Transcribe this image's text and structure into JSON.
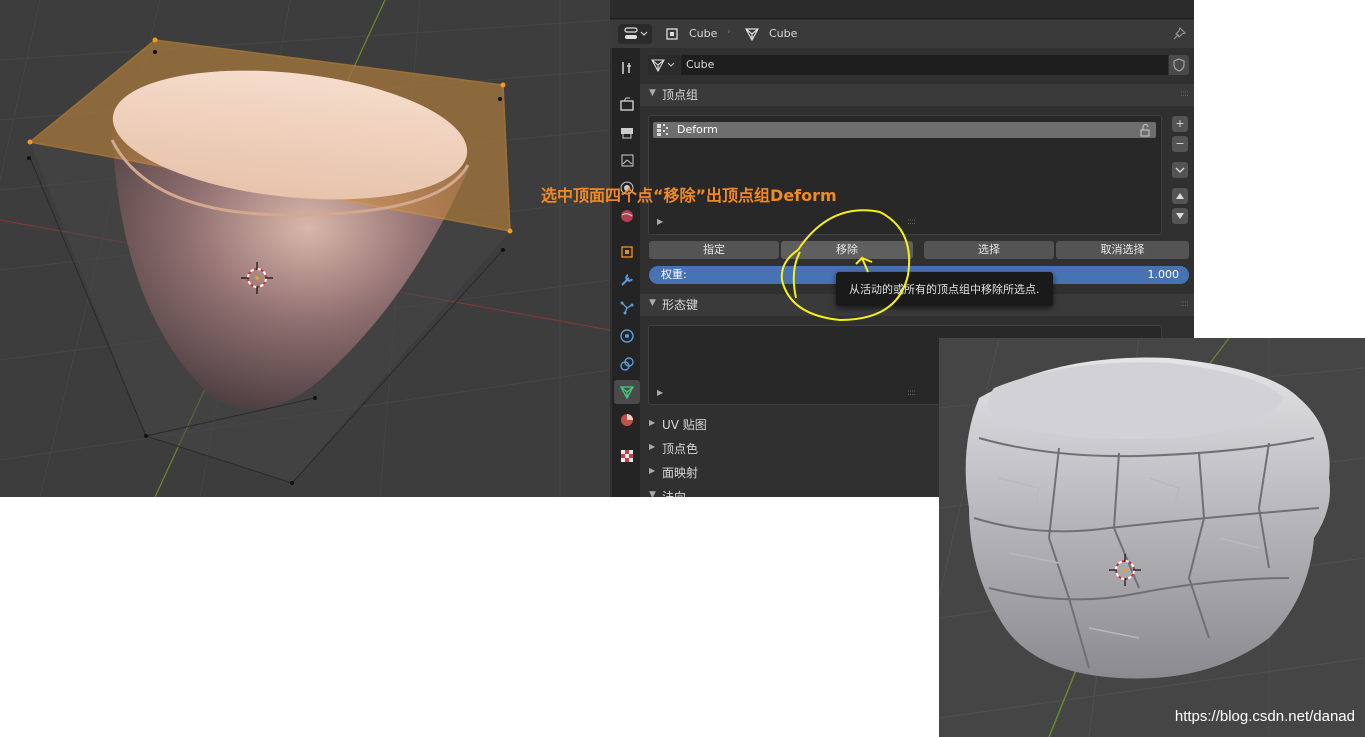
{
  "annotation": {
    "text": "选中顶面四个点“移除”出顶点组Deform",
    "color": "#f08a24"
  },
  "properties": {
    "breadcrumb": {
      "object_name": "Cube",
      "mesh_name": "Cube"
    },
    "mesh_field": {
      "value": "Cube"
    },
    "vertex_groups": {
      "title": "顶点组",
      "items": [
        {
          "name": "Deform"
        }
      ],
      "buttons": {
        "assign": "指定",
        "remove": "移除",
        "select": "选择",
        "deselect": "取消选择"
      },
      "weight_label": "权重:",
      "weight_value": "1.000",
      "tooltip": "从活动的或所有的顶点组中移除所选点."
    },
    "shape_keys": {
      "title": "形态键"
    },
    "collapsed_panels": [
      "UV 贴图",
      "顶点色",
      "面映射",
      "法向"
    ],
    "tabs": [
      "tool-icon",
      "render-icon",
      "output-icon",
      "view-layer-icon",
      "scene-icon",
      "world-icon",
      "object-icon",
      "modifier-icon",
      "particles-icon",
      "physics-icon",
      "constraints-icon",
      "data-icon",
      "material-icon",
      "texture-icon"
    ],
    "accent_color": "#4772b3"
  },
  "watermark": "https://blog.csdn.net/danad"
}
